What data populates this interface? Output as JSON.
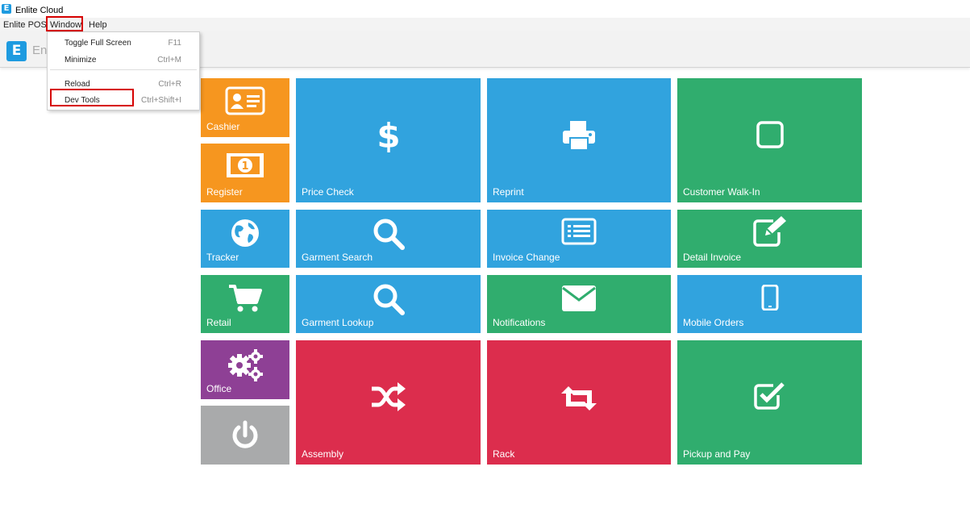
{
  "window": {
    "title": "Enlite Cloud",
    "logo_letter": "E"
  },
  "menubar": {
    "items": [
      "Enlite POS",
      "Window",
      "Help"
    ]
  },
  "header": {
    "brand_letter": "E",
    "brand_text": "En"
  },
  "window_menu": {
    "items": [
      {
        "label": "Toggle Full Screen",
        "shortcut": "F11"
      },
      {
        "label": "Minimize",
        "shortcut": "Ctrl+M"
      },
      {
        "label": "Reload",
        "shortcut": "Ctrl+R"
      },
      {
        "label": "Dev Tools",
        "shortcut": "Ctrl+Shift+I"
      }
    ]
  },
  "tiles": {
    "cashier": "Cashier",
    "register": "Register",
    "tracker": "Tracker",
    "retail": "Retail",
    "office": "Office",
    "power": "",
    "price_check": "Price Check",
    "reprint": "Reprint",
    "customer_walk_in": "Customer Walk-In",
    "garment_search": "Garment Search",
    "invoice_change": "Invoice Change",
    "detail_invoice": "Detail Invoice",
    "garment_lookup": "Garment Lookup",
    "notifications": "Notifications",
    "mobile_orders": "Mobile Orders",
    "assembly": "Assembly",
    "rack": "Rack",
    "pickup_and_pay": "Pickup and Pay"
  },
  "colors": {
    "orange": "#f6961f",
    "blue": "#31a3de",
    "green": "#30ad6e",
    "purple": "#8e4095",
    "red": "#dc2d4d",
    "grey": "#a9aaab",
    "highlight": "#d60000"
  }
}
